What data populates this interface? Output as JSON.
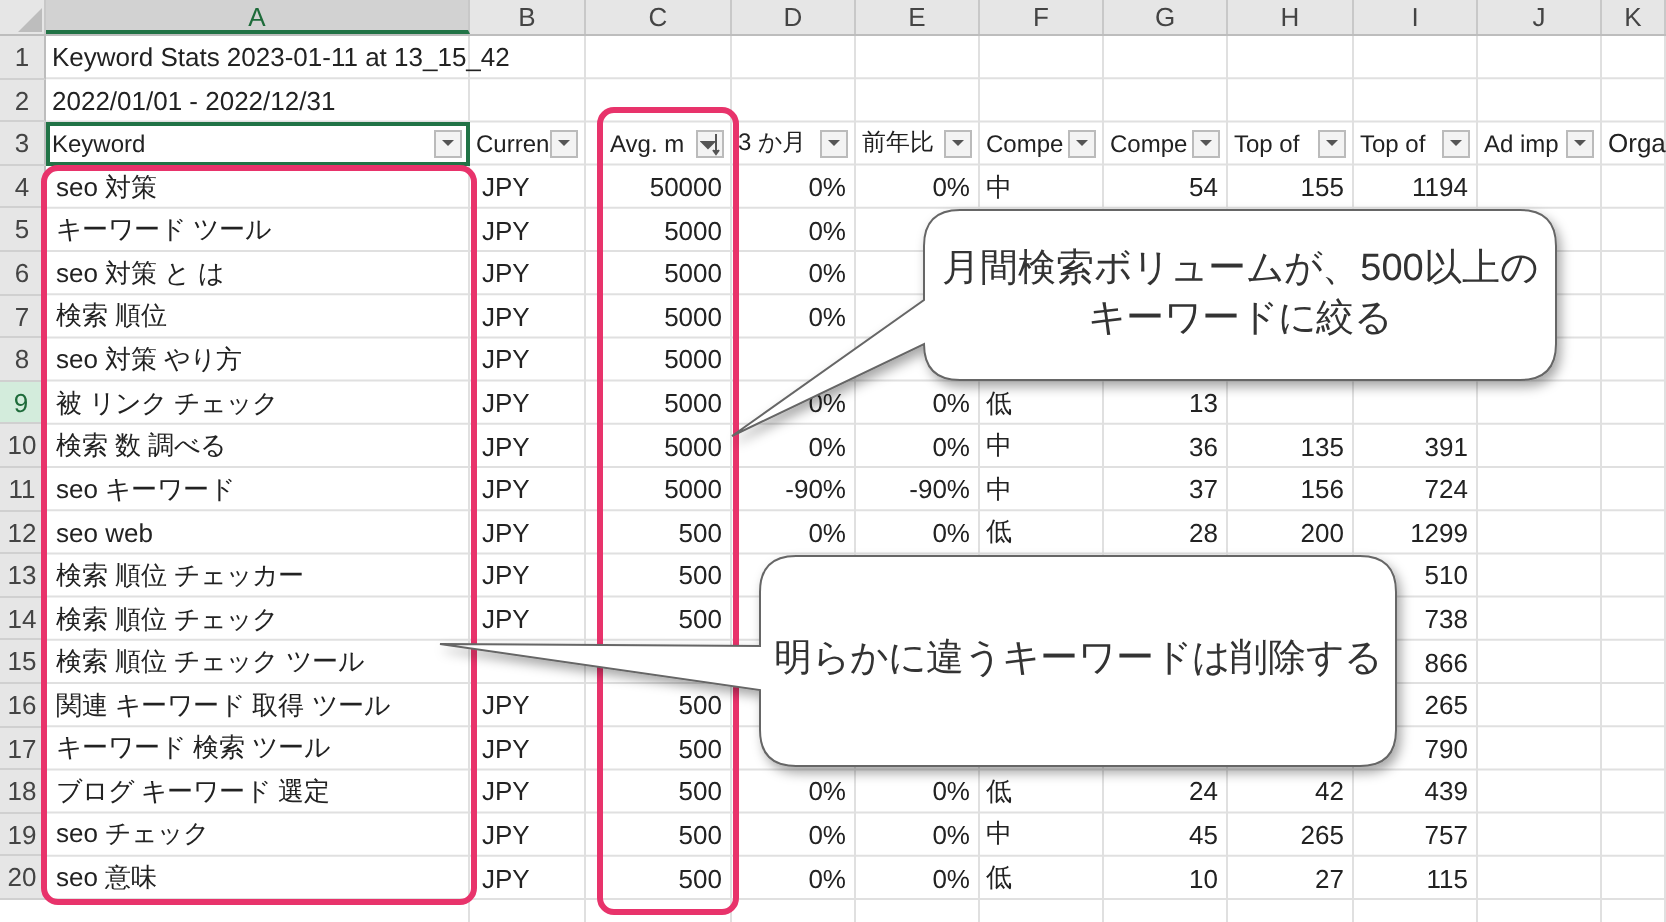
{
  "column_headers": [
    {
      "label": "A",
      "selected": true
    },
    {
      "label": "B",
      "selected": false
    },
    {
      "label": "C",
      "selected": false
    },
    {
      "label": "D",
      "selected": false
    },
    {
      "label": "E",
      "selected": false
    },
    {
      "label": "F",
      "selected": false
    },
    {
      "label": "G",
      "selected": false
    },
    {
      "label": "H",
      "selected": false
    },
    {
      "label": "I",
      "selected": false
    },
    {
      "label": "J",
      "selected": false
    },
    {
      "label": "K",
      "selected": false
    }
  ],
  "title_rows": [
    {
      "number": "1",
      "selected": false,
      "text": "Keyword Stats 2023-01-11 at 13_15_42"
    },
    {
      "number": "2",
      "selected": false,
      "text": "2022/01/01 - 2022/12/31"
    }
  ],
  "header_row": {
    "number": "3",
    "selected": false,
    "filters": [
      {
        "label": "Keyword",
        "sorted": false,
        "selected": true
      },
      {
        "label": "Curren",
        "sorted": false,
        "selected": false
      },
      {
        "label": "Avg. m",
        "sorted": true,
        "selected": false
      },
      {
        "label": "3 か月",
        "sorted": false,
        "selected": false
      },
      {
        "label": "前年比",
        "sorted": false,
        "selected": false
      },
      {
        "label": "Compe",
        "sorted": false,
        "selected": false
      },
      {
        "label": "Compe",
        "sorted": false,
        "selected": false
      },
      {
        "label": "Top of",
        "sorted": false,
        "selected": false
      },
      {
        "label": "Top of",
        "sorted": false,
        "selected": false
      },
      {
        "label": "Ad imp",
        "sorted": false,
        "selected": false
      }
    ],
    "col_k": "Orga"
  },
  "rows": [
    {
      "number": "4",
      "selected": false,
      "col_a": "seo 対策",
      "col_b": "JPY",
      "col_c": "50000",
      "col_d": "0%",
      "col_e": "0%",
      "col_f": "中",
      "col_g": "54",
      "col_h": "155",
      "col_i": "1194"
    },
    {
      "number": "5",
      "selected": false,
      "col_a": "キーワード ツール",
      "col_b": "JPY",
      "col_c": "5000",
      "col_d": "0%"
    },
    {
      "number": "6",
      "selected": false,
      "col_a": "seo 対策 と は",
      "col_b": "JPY",
      "col_c": "5000",
      "col_d": "0%"
    },
    {
      "number": "7",
      "selected": false,
      "col_a": "検索 順位",
      "col_b": "JPY",
      "col_c": "5000",
      "col_d": "0%"
    },
    {
      "number": "8",
      "selected": false,
      "col_a": "seo 対策 やり方",
      "col_b": "JPY",
      "col_c": "5000"
    },
    {
      "number": "9",
      "selected": true,
      "col_a": "被 リンク チェック",
      "col_b": "JPY",
      "col_c": "5000",
      "col_d": "0%",
      "col_e": "0%",
      "col_f": "低",
      "col_g": "13"
    },
    {
      "number": "10",
      "selected": false,
      "col_a": "検索 数 調べる",
      "col_b": "JPY",
      "col_c": "5000",
      "col_d": "0%",
      "col_e": "0%",
      "col_f": "中",
      "col_g": "36",
      "col_h": "135",
      "col_i": "391"
    },
    {
      "number": "11",
      "selected": false,
      "col_a": "seo キーワード",
      "col_b": "JPY",
      "col_c": "5000",
      "col_d": "-90%",
      "col_e": "-90%",
      "col_f": "中",
      "col_g": "37",
      "col_h": "156",
      "col_i": "724"
    },
    {
      "number": "12",
      "selected": false,
      "col_a": "seo web",
      "col_b": "JPY",
      "col_c": "500",
      "col_d": "0%",
      "col_e": "0%",
      "col_f": "低",
      "col_g": "28",
      "col_h": "200",
      "col_i": "1299"
    },
    {
      "number": "13",
      "selected": false,
      "col_a": "検索 順位 チェッカー",
      "col_b": "JPY",
      "col_c": "500",
      "col_i": "510"
    },
    {
      "number": "14",
      "selected": false,
      "col_a": "検索 順位 チェック",
      "col_b": "JPY",
      "col_c": "500",
      "col_i": "738"
    },
    {
      "number": "15",
      "selected": false,
      "col_a": "検索 順位 チェック ツール",
      "col_i": "866"
    },
    {
      "number": "16",
      "selected": false,
      "col_a": "関連 キーワード 取得 ツール",
      "col_b": "JPY",
      "col_c": "500",
      "col_i": "265"
    },
    {
      "number": "17",
      "selected": false,
      "col_a": "キーワード 検索 ツール",
      "col_b": "JPY",
      "col_c": "500",
      "col_i": "790"
    },
    {
      "number": "18",
      "selected": false,
      "col_a": "ブログ キーワード 選定",
      "col_b": "JPY",
      "col_c": "500",
      "col_d": "0%",
      "col_e": "0%",
      "col_f": "低",
      "col_g": "24",
      "col_h": "42",
      "col_i": "439"
    },
    {
      "number": "19",
      "selected": false,
      "col_a": "seo チェック",
      "col_b": "JPY",
      "col_c": "500",
      "col_d": "0%",
      "col_e": "0%",
      "col_f": "中",
      "col_g": "45",
      "col_h": "265",
      "col_i": "757"
    },
    {
      "number": "20",
      "selected": false,
      "col_a": "seo 意味",
      "col_b": "JPY",
      "col_c": "500",
      "col_d": "0%",
      "col_e": "0%",
      "col_f": "低",
      "col_g": "10",
      "col_h": "27",
      "col_i": "115"
    }
  ],
  "callouts": [
    {
      "lines": [
        "月間検索ボリュームが、500以上の",
        "キーワードに絞る"
      ]
    },
    {
      "lines": [
        "明らかに違うキーワードは削除する"
      ]
    }
  ]
}
